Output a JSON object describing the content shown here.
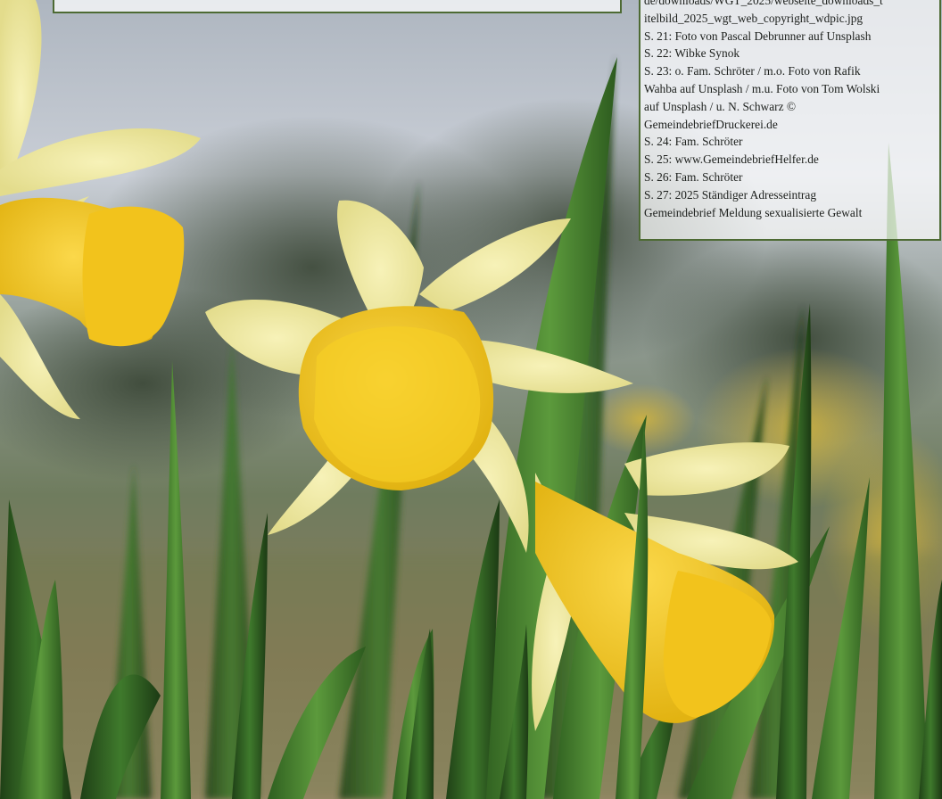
{
  "photo": {
    "subject": "daffodils",
    "colors": {
      "sky": "#c9ced6",
      "tree": "#3d4a3a",
      "petal": "#f0eca8",
      "trumpet": "#f5cc1e",
      "leaf": "#3f7a2c",
      "ground": "#8c7c5c"
    }
  },
  "credits": {
    "lines": [
      "de/downloads/WGT_2025/webseite_downloads_t",
      "itelbild_2025_wgt_web_copyright_wdpic.jpg",
      "S. 21: Foto von Pascal Debrunner auf Unsplash",
      "S. 22: Wibke Synok",
      "S. 23: o. Fam. Schröter / m.o. Foto von Rafik",
      "Wahba auf Unsplash / m.u. Foto von Tom Wolski",
      "auf Unsplash / u. N. Schwarz ©",
      "GemeindebriefDruckerei.de",
      "S. 24: Fam. Schröter",
      "S. 25: www.GemeindebriefHelfer.de",
      "S. 26: Fam. Schröter",
      "S. 27: 2025 Ständiger Adresseintrag",
      "Gemeindebrief Meldung sexualisierte Gewalt"
    ]
  }
}
